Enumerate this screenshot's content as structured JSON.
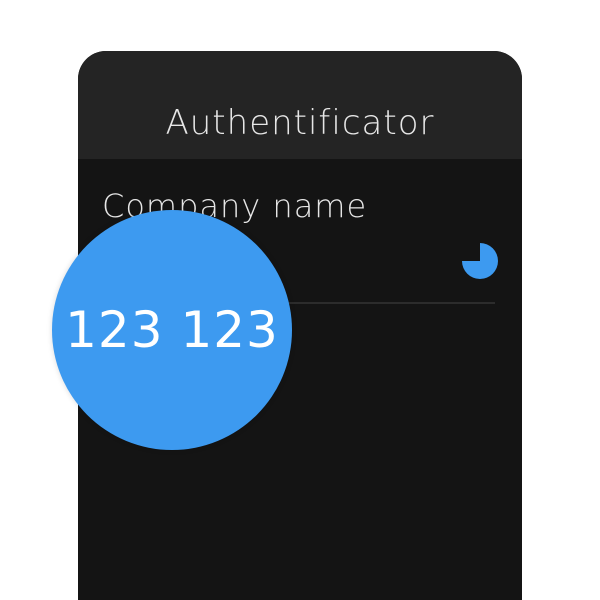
{
  "app": {
    "title": "Authentificator"
  },
  "account": {
    "company_name": "Company name",
    "code": "123 123",
    "timer_icon": "countdown-pie-icon",
    "timer_remaining_fraction": 0.75
  },
  "colors": {
    "accent": "#3d9af0",
    "app_bar": "#242424",
    "background": "#141414",
    "text": "#e6e6e6"
  }
}
